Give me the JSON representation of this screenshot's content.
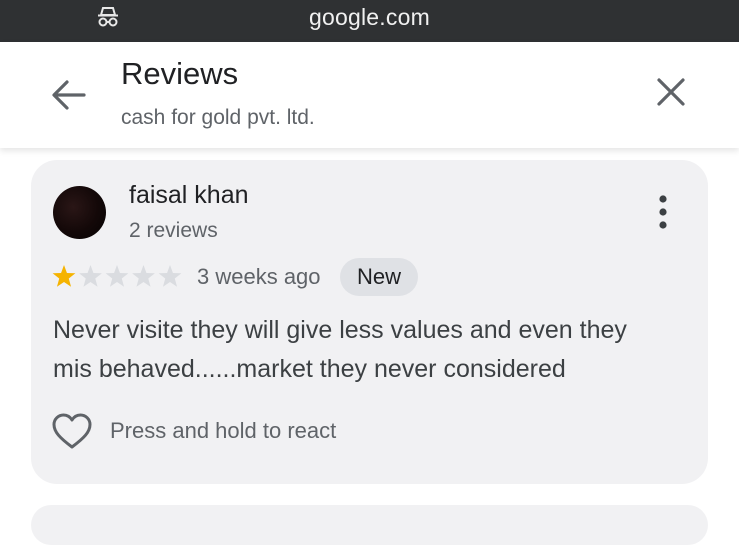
{
  "browser": {
    "url": "google.com",
    "incognito_icon": "incognito-icon"
  },
  "header": {
    "title": "Reviews",
    "subtitle": "cash for gold pvt. ltd.",
    "back_icon": "arrow-back-icon",
    "close_icon": "close-icon"
  },
  "review": {
    "author": "faisal khan",
    "review_count": "2 reviews",
    "rating": 1,
    "rating_max": 5,
    "time": "3 weeks ago",
    "badge": "New",
    "text_line1": "Never visite they will give less values and even they",
    "text_line2": "mis behaved......market they never considered",
    "react_label": "Press and hold to react",
    "more_icon": "more-vert-icon",
    "heart_icon": "heart-outline-icon"
  },
  "colors": {
    "star_filled": "#f5b300",
    "star_empty": "#dadce0",
    "card_bg": "#f1f1f3",
    "top_bar": "#2f3133"
  }
}
